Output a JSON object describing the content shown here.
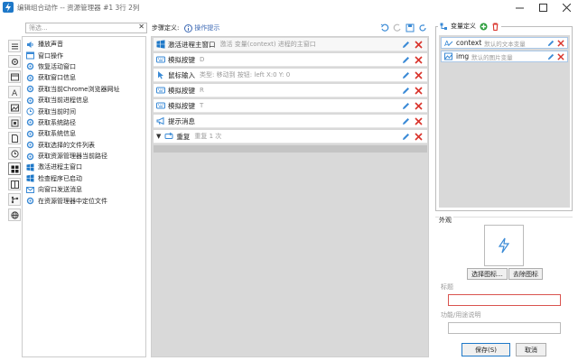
{
  "window": {
    "title": "编辑组合动作 -- 资源管理器 #1 3行 2列"
  },
  "search": {
    "placeholder": "筛选...",
    "clear": "✕"
  },
  "actions": [
    "播放声音",
    "窗口操作",
    "恢复活动窗口",
    "获取窗口信息",
    "获取当前Chrome浏览器网址",
    "获取当前进程信息",
    "获取当前时间",
    "获取系统路径",
    "获取系统信息",
    "获取选择的文件列表",
    "获取资源管理器当前路径",
    "激活进程主窗口",
    "检查程序已启动",
    "向窗口发送消息",
    "在资源管理器中定位文件"
  ],
  "steps_header": {
    "label": "步骤定义:",
    "hint": "操作提示"
  },
  "steps": [
    {
      "name": "激活进程主窗口",
      "desc": "激活 变量(context) 进程的主窗口"
    },
    {
      "name": "模拟按键",
      "desc": "D"
    },
    {
      "name": "鼠标输入",
      "desc": "类型: 移动到  按钮: left  X:0  Y: 0"
    },
    {
      "name": "模拟按键",
      "desc": "R"
    },
    {
      "name": "模拟按键",
      "desc": "T"
    },
    {
      "name": "提示消息",
      "desc": ""
    },
    {
      "name": "重复",
      "desc": "重复 1 次"
    }
  ],
  "vars": {
    "title": "变量定义",
    "items": [
      {
        "name": "context",
        "desc": "默认的文本变量"
      },
      {
        "name": "img",
        "desc": "默认的图片变量"
      }
    ]
  },
  "appearance": {
    "title": "外观",
    "choose": "选择图标...",
    "remove": "去除图标",
    "label_title": "标题",
    "label_desc": "功能/用途说明",
    "title_value": "",
    "desc_value": ""
  },
  "footer": {
    "save": "保存(S)",
    "cancel": "取消"
  },
  "colors": {
    "accent": "#1e78c8",
    "danger": "#d9332b",
    "icon_blue": "#3a8ad6",
    "add_green": "#2e9e3e"
  }
}
